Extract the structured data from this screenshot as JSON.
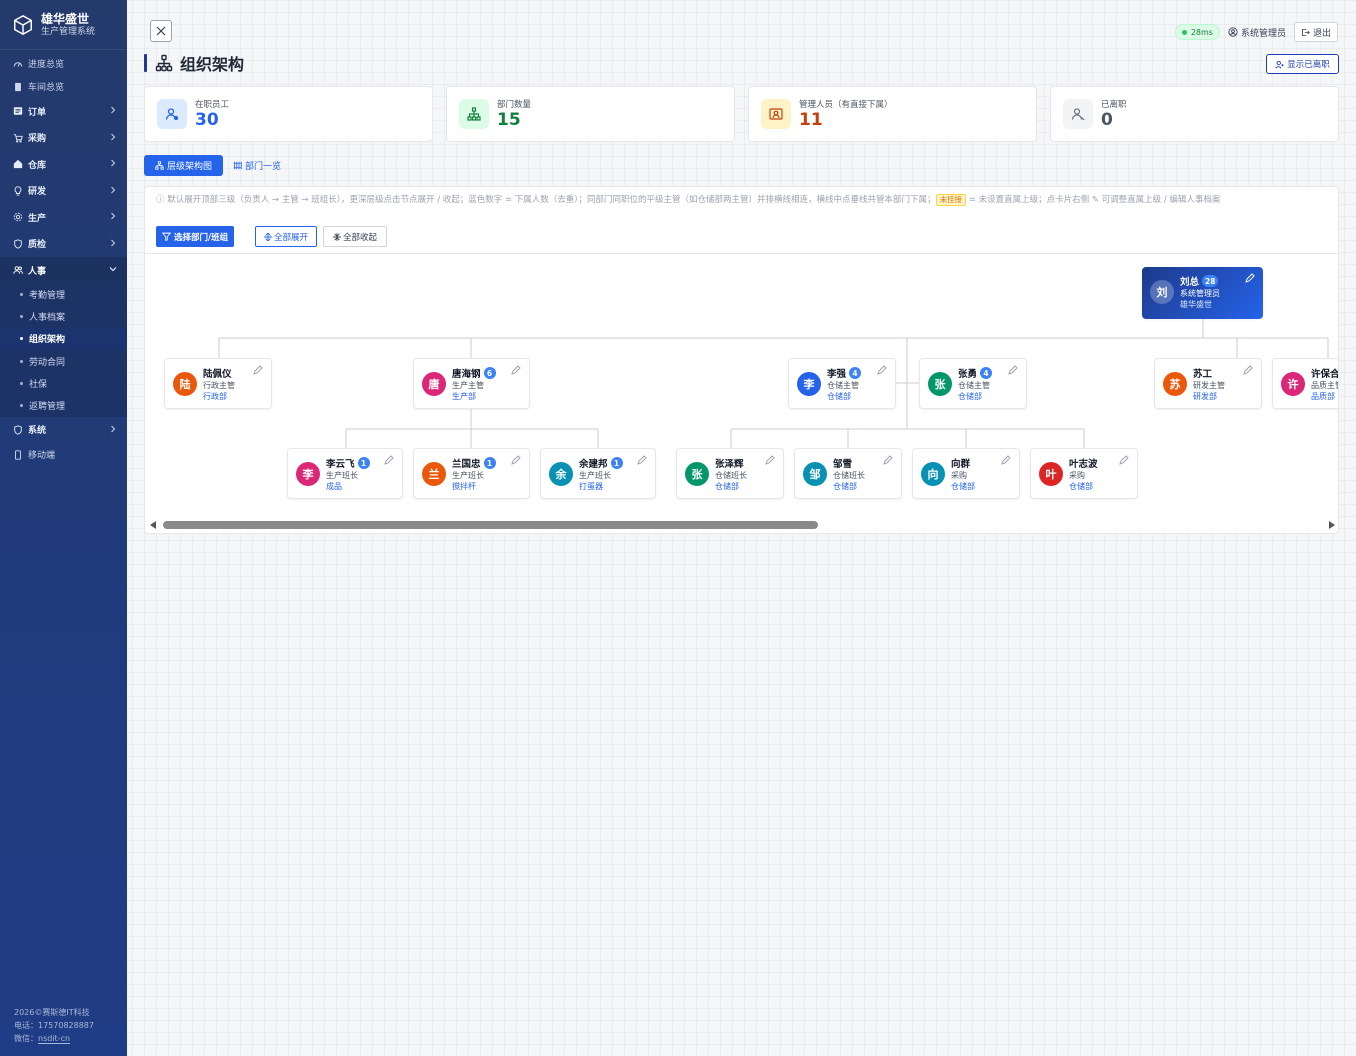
{
  "brand": {
    "name": "雄华盛世",
    "subtitle": "生产管理系统"
  },
  "sidebar": {
    "items": [
      {
        "label": "进度总览",
        "icon": "dashboard-icon",
        "type": "small"
      },
      {
        "label": "车间总览",
        "icon": "doc-icon",
        "type": "small"
      },
      {
        "label": "订单",
        "icon": "list-icon",
        "type": "group"
      },
      {
        "label": "采购",
        "icon": "cart-icon",
        "type": "group"
      },
      {
        "label": "仓库",
        "icon": "home-icon",
        "type": "group"
      },
      {
        "label": "研发",
        "icon": "bulb-icon",
        "type": "group"
      },
      {
        "label": "生产",
        "icon": "gear-icon",
        "type": "group"
      },
      {
        "label": "质检",
        "icon": "shield-icon",
        "type": "group"
      },
      {
        "label": "人事",
        "icon": "users-icon",
        "type": "group-open"
      }
    ],
    "hr_sub": [
      "考勤管理",
      "人事档案",
      "组织架构",
      "劳动合同",
      "社保",
      "返聘管理"
    ],
    "hr_active": "组织架构",
    "after": [
      {
        "label": "系统",
        "icon": "shield-icon",
        "type": "group"
      },
      {
        "label": "移动端",
        "icon": "phone-icon",
        "type": "small"
      }
    ],
    "footer": {
      "copyright": "2026©赛斯德IT科技",
      "phone": "电话：17570828887",
      "wechat_label": "微信：",
      "wechat": "nsdit-cn"
    }
  },
  "topbar": {
    "ping": "28ms",
    "user": "系统管理员",
    "logout": "退出"
  },
  "page": {
    "title": "组织架构",
    "show_left": "显示已离职"
  },
  "stats": [
    {
      "label": "在职员工",
      "value": "30",
      "color": "#2563eb",
      "bg": "#dbeafe",
      "icon": "user-icon"
    },
    {
      "label": "部门数量",
      "value": "15",
      "color": "#15803d",
      "bg": "#dcfce7",
      "icon": "org-icon"
    },
    {
      "label": "管理人员（有直接下属）",
      "value": "11",
      "color": "#c2410c",
      "bg": "#fef3c7",
      "icon": "manager-icon"
    },
    {
      "label": "已离职",
      "value": "0",
      "color": "#4b5563",
      "bg": "#f3f4f6",
      "icon": "user-off-icon"
    }
  ],
  "tabs": {
    "tree": "层级架构图",
    "list": "部门一览"
  },
  "hint": {
    "a": "ⓘ 默认展开顶部三级（负责人 → 主管 → 班组长），更深层级点击节点展开 / 收起；蓝色数字 = 下属人数（去重）；同部门同职位的平级主管（如仓储部两主管）并排横线相连，横线中点垂线共管本部门下属；",
    "tag": "未挂接",
    "b": " = 未设置直属上级；点卡片右侧 ✎ 可调整直属上级 / 编辑人事档案"
  },
  "toolbar": {
    "filter": "选择部门/班组",
    "expand": "全部展开",
    "collapse": "全部收起"
  },
  "nodes": {
    "root": {
      "avatar": "刘",
      "name": "刘总",
      "count": "28",
      "position": "系统管理员",
      "dept": "雄华盛世"
    },
    "lpy": {
      "avatar": "陆",
      "name": "陆佩仪",
      "count": "",
      "position": "行政主管",
      "dept": "行政部",
      "color": "#ea580c"
    },
    "thg": {
      "avatar": "唐",
      "name": "唐海钢",
      "count": "6",
      "position": "生产主管",
      "dept": "生产部",
      "color": "#db2777"
    },
    "lq": {
      "avatar": "李",
      "name": "李强",
      "count": "4",
      "position": "仓储主管",
      "dept": "仓储部",
      "color": "#2563eb"
    },
    "zy": {
      "avatar": "张",
      "name": "张勇",
      "count": "4",
      "position": "仓储主管",
      "dept": "仓储部",
      "color": "#059669"
    },
    "sg": {
      "avatar": "苏",
      "name": "苏工",
      "count": "",
      "position": "研发主管",
      "dept": "研发部",
      "color": "#ea580c"
    },
    "xbh": {
      "avatar": "许",
      "name": "许保合",
      "count": "",
      "position": "品质主管",
      "dept": "品质部",
      "color": "#db2777"
    },
    "lyf": {
      "avatar": "李",
      "name": "李云飞",
      "count": "1",
      "position": "生产班长",
      "dept": "成品",
      "color": "#db2777"
    },
    "lgz": {
      "avatar": "兰",
      "name": "兰国忠",
      "count": "1",
      "position": "生产班长",
      "dept": "搅拌杆",
      "color": "#ea580c"
    },
    "yjb": {
      "avatar": "余",
      "name": "余建邦",
      "count": "1",
      "position": "生产班长",
      "dept": "打蛋器",
      "color": "#0891b2"
    },
    "zzh": {
      "avatar": "张",
      "name": "张泽辉",
      "count": "",
      "position": "仓储班长",
      "dept": "仓储部",
      "color": "#059669"
    },
    "zl": {
      "avatar": "邹",
      "name": "邹雪",
      "count": "",
      "position": "仓储班长",
      "dept": "仓储部",
      "color": "#0891b2"
    },
    "xq": {
      "avatar": "向",
      "name": "向群",
      "count": "",
      "position": "采购",
      "dept": "仓储部",
      "color": "#0891b2"
    },
    "yzb": {
      "avatar": "叶",
      "name": "叶志波",
      "count": "",
      "position": "采购",
      "dept": "仓储部",
      "color": "#dc2626"
    }
  }
}
